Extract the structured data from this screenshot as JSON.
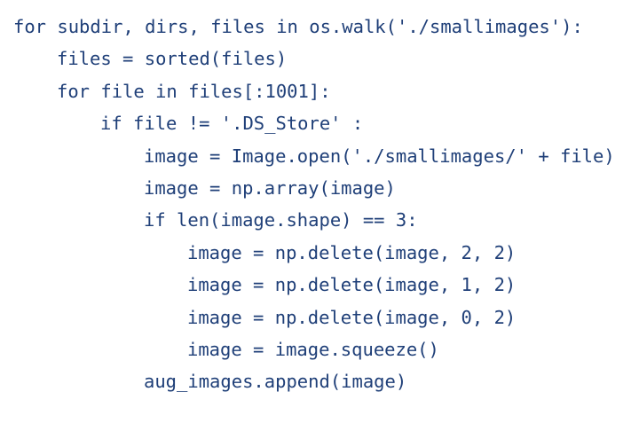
{
  "code": {
    "lines": [
      {
        "text": "for subdir, dirs, files in os.walk('./smallimages'):",
        "indent": 0
      },
      {
        "text": "files = sorted(files)",
        "indent": 1
      },
      {
        "text": "for file in files[:1001]:",
        "indent": 1
      },
      {
        "text": "if file != '.DS_Store' :",
        "indent": 2
      },
      {
        "text": "image = Image.open('./smallimages/' + file)",
        "indent": 3
      },
      {
        "text": "image = np.array(image)",
        "indent": 3
      },
      {
        "text": "if len(image.shape) == 3:",
        "indent": 3
      },
      {
        "text": "image = np.delete(image, 2, 2)",
        "indent": 4
      },
      {
        "text": "image = np.delete(image, 1, 2)",
        "indent": 4
      },
      {
        "text": "image = np.delete(image, 0, 2)",
        "indent": 4
      },
      {
        "text": "image = image.squeeze()",
        "indent": 4
      },
      {
        "text": "aug_images.append(image)",
        "indent": 3
      }
    ],
    "text_color": "#1f3f78",
    "background_color": "#ffffff"
  }
}
